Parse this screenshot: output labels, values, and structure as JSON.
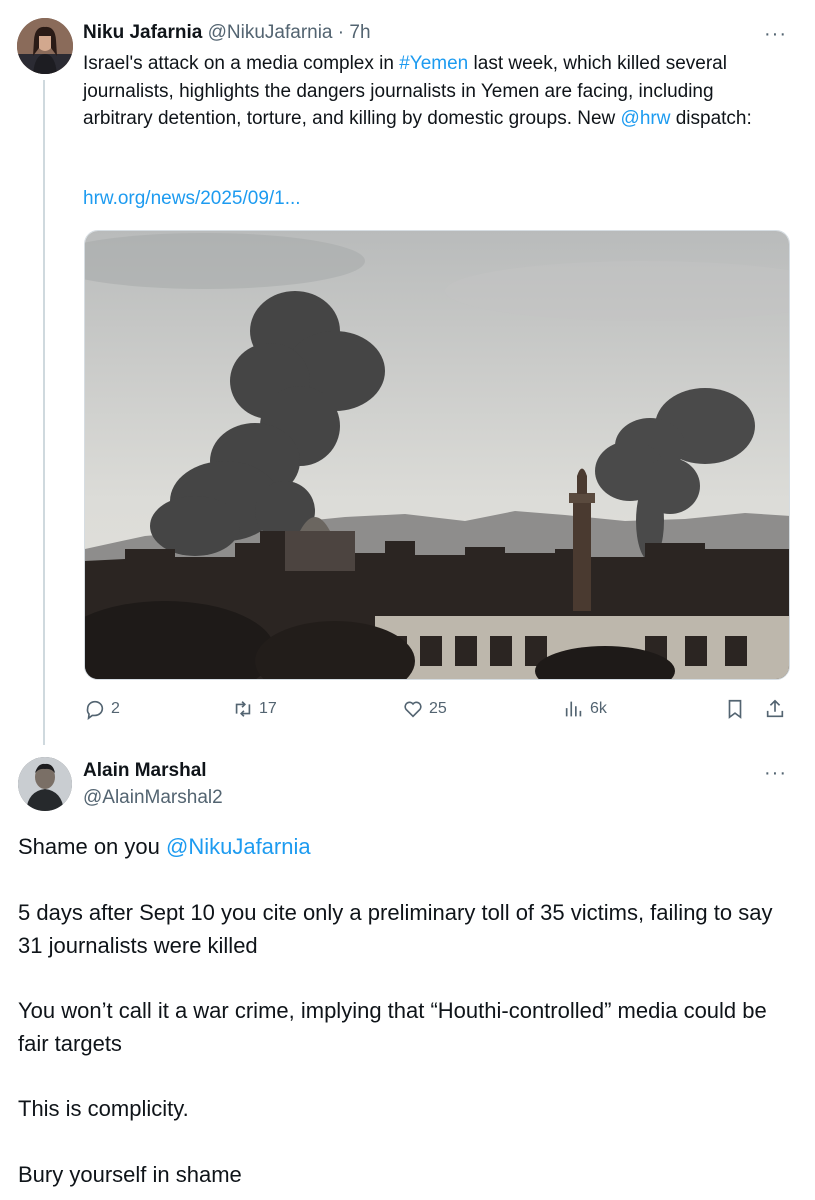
{
  "tweet1": {
    "author_name": "Niku Jafarnia",
    "author_handle": "@NikuJafarnia",
    "separator": "·",
    "time": "7h",
    "more": "···",
    "text_1": "Israel's attack on a media complex in ",
    "hashtag": "#Yemen",
    "text_2": " last week, which killed several journalists, highlights the dangers journalists in Yemen are facing, including arbitrary detention, torture, and killing by domestic groups. New ",
    "mention": "@hrw",
    "text_3": " dispatch:",
    "link": "hrw.org/news/2025/09/1...",
    "media_icon": "photo-smoke-over-city",
    "actions": {
      "replies": "2",
      "reposts": "17",
      "likes": "25",
      "views": "6k"
    }
  },
  "tweet2": {
    "author_name": "Alain Marshal",
    "author_handle": "@AlainMarshal2",
    "more": "···",
    "line1_text": "Shame on you ",
    "line1_mention": "@NikuJafarnia",
    "para2": "5 days after Sept 10 you cite only a preliminary toll of 35 victims, failing to say 31 journalists were killed",
    "para3": "You won’t call it a war crime, implying that “Houthi-controlled” media could be fair targets",
    "para4": "This is complicity.",
    "para5": "Bury yourself in shame"
  },
  "colors": {
    "link": "#1d9bf0",
    "secondary_text": "#536471",
    "thread_line": "#cfd9de"
  }
}
